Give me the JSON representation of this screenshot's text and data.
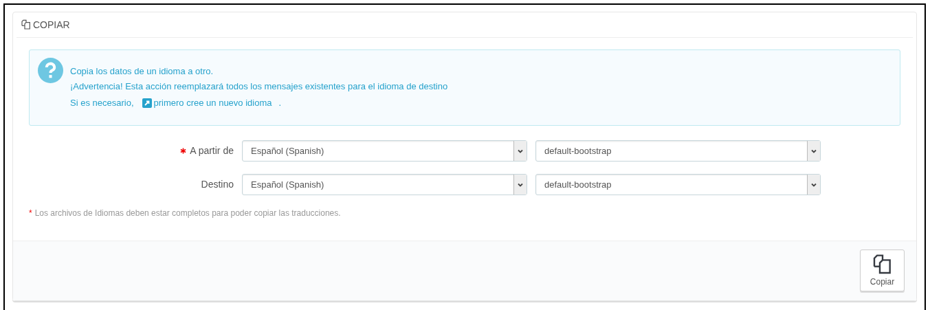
{
  "panel": {
    "title": "COPIAR"
  },
  "alert": {
    "lines": [
      "Copia los datos de un idioma a otro.",
      "¡Advertencia! Esta acción reemplazará todos los mensajes existentes para el idioma de destino"
    ],
    "prefix": "Si es necesario,",
    "link": "primero cree un nuevo idioma",
    "suffix": "."
  },
  "rows": [
    {
      "label": "A partir de",
      "required": true,
      "language": "Español (Spanish)",
      "theme": "default-bootstrap"
    },
    {
      "label": "Destino",
      "required": false,
      "language": "Español (Spanish)",
      "theme": "default-bootstrap"
    }
  ],
  "footnote": {
    "mark": "*",
    "text": "Los archivos de Idiomas deben estar completos para poder copiar las traducciones."
  },
  "button": {
    "label": "Copiar"
  }
}
